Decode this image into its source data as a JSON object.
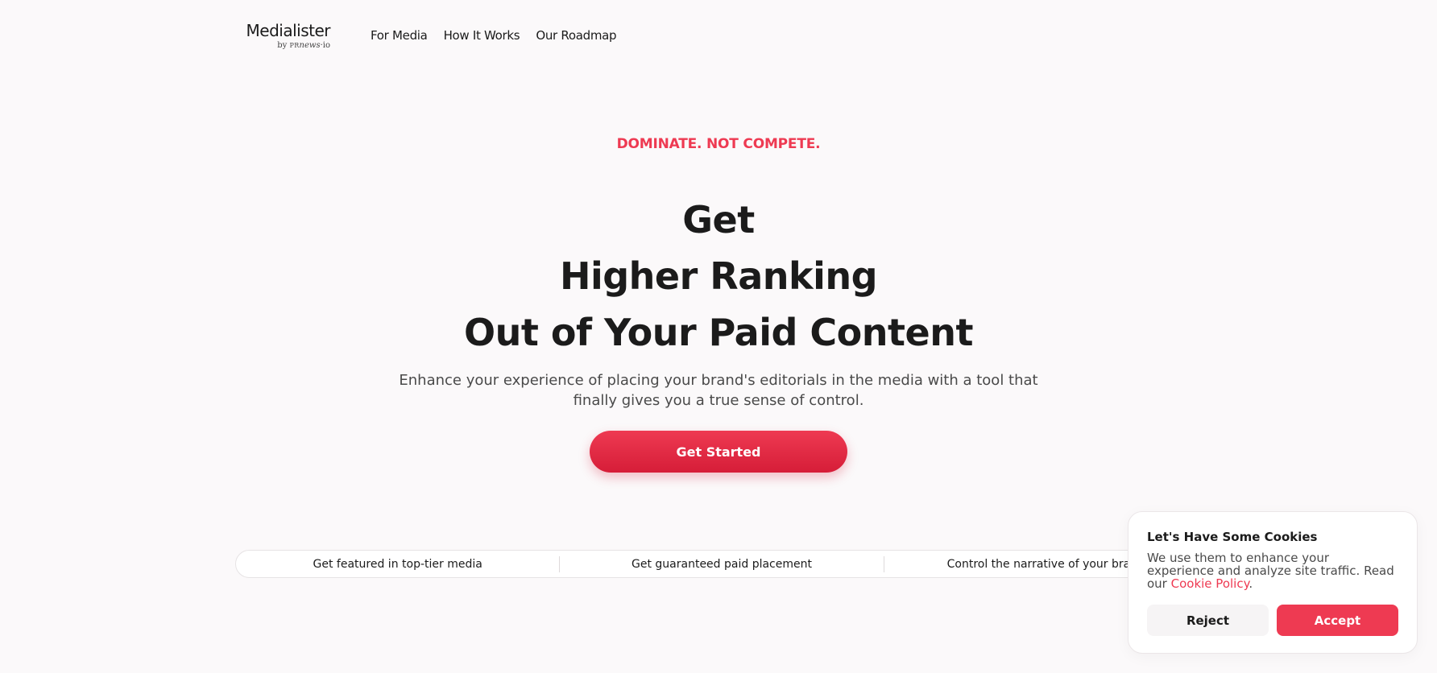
{
  "header": {
    "logo": {
      "name": "Medialister",
      "by": "by",
      "pr": "PR",
      "news": "news",
      "dot": "·",
      "io": "io"
    },
    "nav": [
      {
        "label": "For Media"
      },
      {
        "label": "How It Works"
      },
      {
        "label": "Our Roadmap"
      }
    ]
  },
  "hero": {
    "eyebrow": "DOMINATE. NOT COMPETE.",
    "headline": [
      "Get",
      "Higher Ranking",
      "Out of Your Paid Content"
    ],
    "subtitle": "Enhance your experience of placing your brand's editorials in the media with a tool that finally gives you a true sense of control.",
    "cta_label": "Get Started"
  },
  "features": [
    {
      "label": "Get featured in top-tier media"
    },
    {
      "label": "Get guaranteed paid placement"
    },
    {
      "label": "Control the narrative of your brand"
    }
  ],
  "cookie": {
    "title": "Let's Have Some Cookies",
    "text": "We use them to enhance your experience and analyze site traffic. Read our ",
    "link": "Cookie Policy",
    "period": ".",
    "reject_label": "Reject",
    "accept_label": "Accept"
  },
  "colors": {
    "accent": "#ee3a52",
    "background": "#fbf9fa",
    "text": "#1b1b1b"
  }
}
